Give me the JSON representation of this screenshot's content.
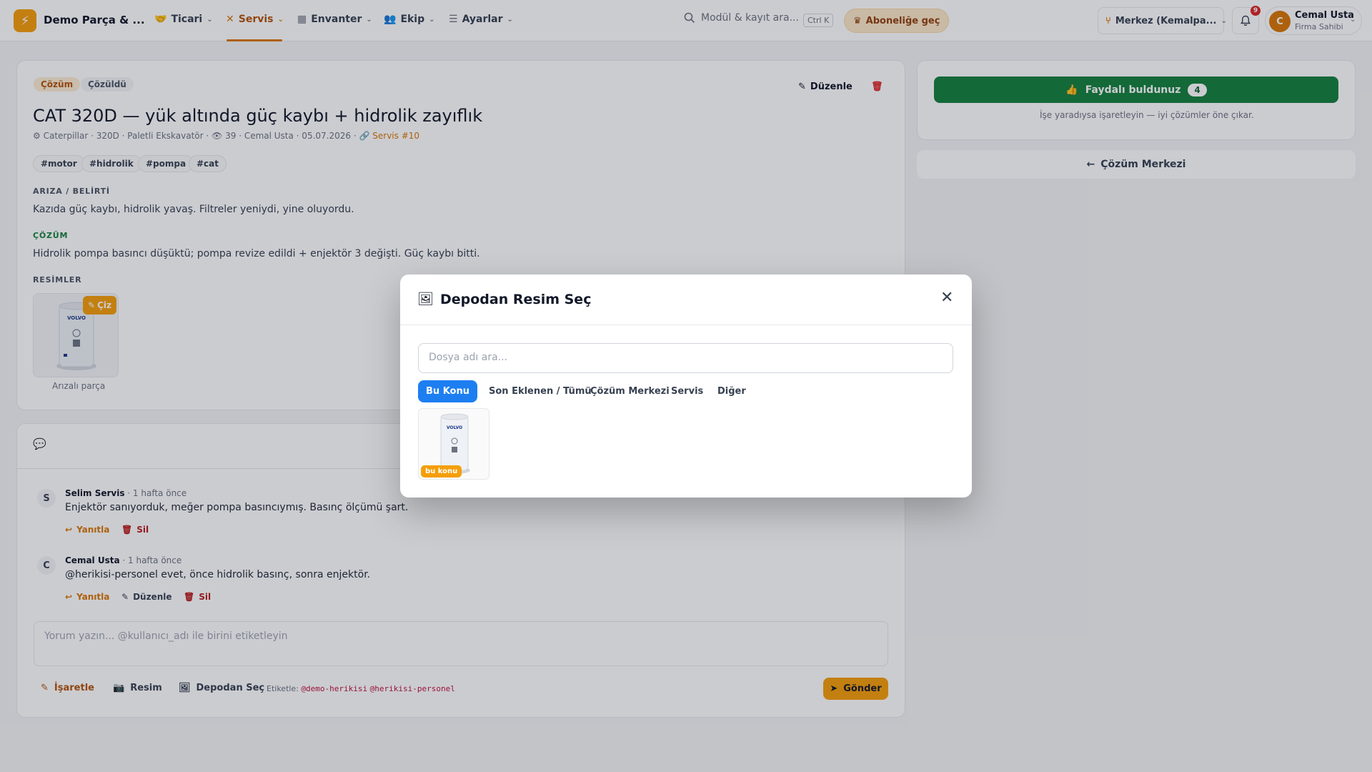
{
  "header": {
    "company": "Demo Parça & ...",
    "nav": [
      {
        "label": "Ticari",
        "icon": "handshake-icon"
      },
      {
        "label": "Servis",
        "icon": "tools-icon"
      },
      {
        "label": "Envanter",
        "icon": "warehouse-icon"
      },
      {
        "label": "Ekip",
        "icon": "users-icon"
      },
      {
        "label": "Ayarlar",
        "icon": "sliders-icon"
      }
    ],
    "active_nav": "Servis",
    "search_placeholder": "Modül & kayıt ara...",
    "search_shortcut": "Ctrl K",
    "upgrade_label": "Aboneliğe geç",
    "branch": "Merkez (Kemalpa...",
    "notification_count": "9",
    "user": {
      "initial": "C",
      "name": "Cemal Usta",
      "role": "Firma Sahibi"
    }
  },
  "solution": {
    "badges": [
      "Çözüm",
      "Çözüldü"
    ],
    "edit_label": "Düzenle",
    "title": "CAT 320D — yük altında güç kaybı + hidrolik zayıflık",
    "meta": {
      "machine": "Caterpillar · 320D · Paletli Ekskavatör ·",
      "views": "39",
      "author_date": "· Cemal Usta · 05.07.2026 ·",
      "service_link": "Servis #10"
    },
    "tags": [
      "#motor",
      "#hidrolik",
      "#pompa",
      "#cat"
    ],
    "symptom_label": "ARIZA / BELİRTİ",
    "symptom_text": "Kazıda güç kaybı, hidrolik yavaş. Filtreler yeniydi, yine oluyordu.",
    "solution_label": "ÇÖZÜM",
    "solution_text": "Hidrolik pompa basıncı düşüktü; pompa revize edildi + enjektör 3 değişti. Güç kaybı bitti.",
    "images_label": "RESİMLER",
    "draw_label": "Çiz",
    "image_caption": "Arızalı parça",
    "image_brand": "VOLVO"
  },
  "sidebar": {
    "helpful_label": "Faydalı buldunuz",
    "helpful_count": "4",
    "helpful_note": "İşe yaradıysa işaretleyin — iyi çözümler öne çıkar.",
    "back_label": "Çözüm Merkezi"
  },
  "comments": {
    "items": [
      {
        "initial": "S",
        "author": "Selim Servis",
        "time": "· 1 hafta önce",
        "text": "Enjektör sanıyorduk, meğer pompa basıncıymış. Basınç ölçümü şart.",
        "actions": [
          "Yanıtla",
          "Sil"
        ]
      },
      {
        "initial": "C",
        "author": "Cemal Usta",
        "time": "· 1 hafta önce",
        "text": "@herikisi-personel evet, önce hidrolik basınç, sonra enjektör.",
        "actions": [
          "Yanıtla",
          "Düzenle",
          "Sil"
        ]
      }
    ],
    "input_placeholder": "Yorum yazın... @kullanıcı_adı ile birini etiketleyin",
    "tools": [
      "İşaretle",
      "Resim",
      "Depodan Seç"
    ],
    "mention_label": "Etiketle:",
    "mentions": [
      "@demo-herikisi",
      "@herikisi-personel"
    ],
    "send_label": "Gönder"
  },
  "modal": {
    "title": "Depodan Resim Seç",
    "search_placeholder": "Dosya adı ara...",
    "tabs": [
      "Bu Konu",
      "Son Eklenen / Tümü",
      "Çözüm Merkezi",
      "Servis",
      "Diğer"
    ],
    "active_tab": "Bu Konu",
    "items": [
      {
        "badge": "bu konu",
        "brand": "VOLVO"
      }
    ]
  },
  "colors": {
    "accent": "#d97706",
    "success": "#15803d",
    "danger": "#dc2626",
    "tab_active": "#1d7ef2"
  }
}
